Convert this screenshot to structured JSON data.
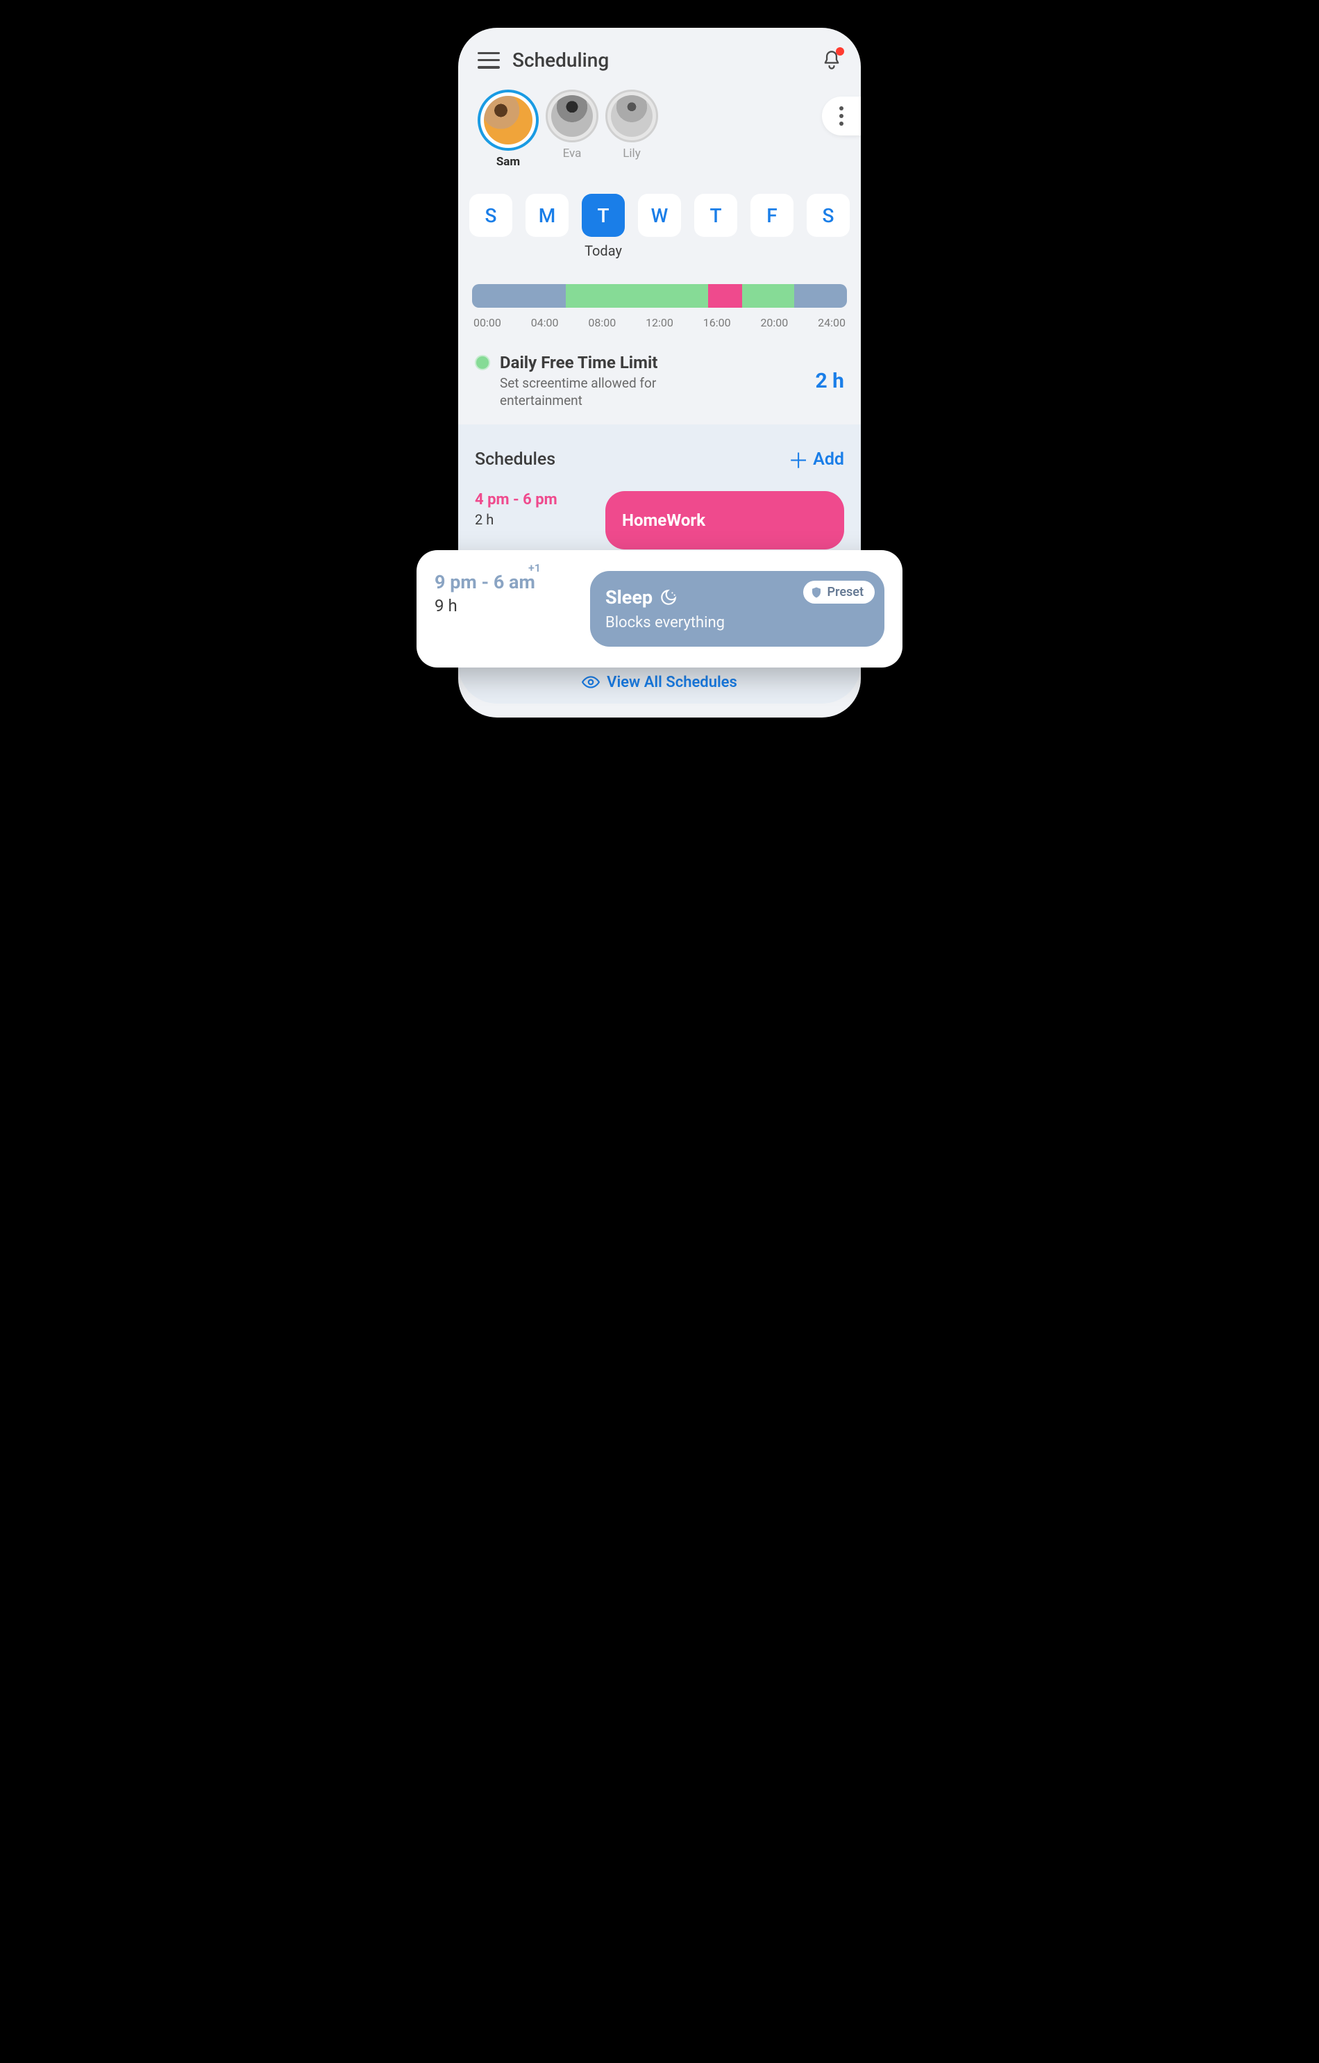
{
  "header": {
    "title": "Scheduling"
  },
  "profiles": [
    {
      "name": "Sam",
      "active": true
    },
    {
      "name": "Eva",
      "active": false
    },
    {
      "name": "Lily",
      "active": false
    }
  ],
  "days": {
    "labels": [
      "S",
      "M",
      "T",
      "W",
      "T",
      "F",
      "S"
    ],
    "active_index": 2,
    "today_label": "Today"
  },
  "timeline": {
    "ticks": [
      "00:00",
      "04:00",
      "08:00",
      "12:00",
      "16:00",
      "20:00",
      "24:00"
    ],
    "segments": [
      {
        "type": "sleep",
        "pct": 25
      },
      {
        "type": "free",
        "pct": 38
      },
      {
        "type": "homework",
        "pct": 9
      },
      {
        "type": "free",
        "pct": 14
      },
      {
        "type": "sleep",
        "pct": 14
      }
    ]
  },
  "limit": {
    "title": "Daily Free Time Limit",
    "subtitle": "Set screentime allowed for entertainment",
    "value": "2 h"
  },
  "schedules": {
    "header": "Schedules",
    "add_label": "Add",
    "homework": {
      "range": "4 pm - 6 pm",
      "duration": "2 h",
      "name": "HomeWork"
    },
    "sleep": {
      "range": "9 pm - 6 am",
      "plus": "+1",
      "duration": "9 h",
      "name": "Sleep",
      "subtitle": "Blocks everything",
      "preset_label": "Preset"
    }
  },
  "footer": {
    "view_all": "View All Schedules"
  }
}
